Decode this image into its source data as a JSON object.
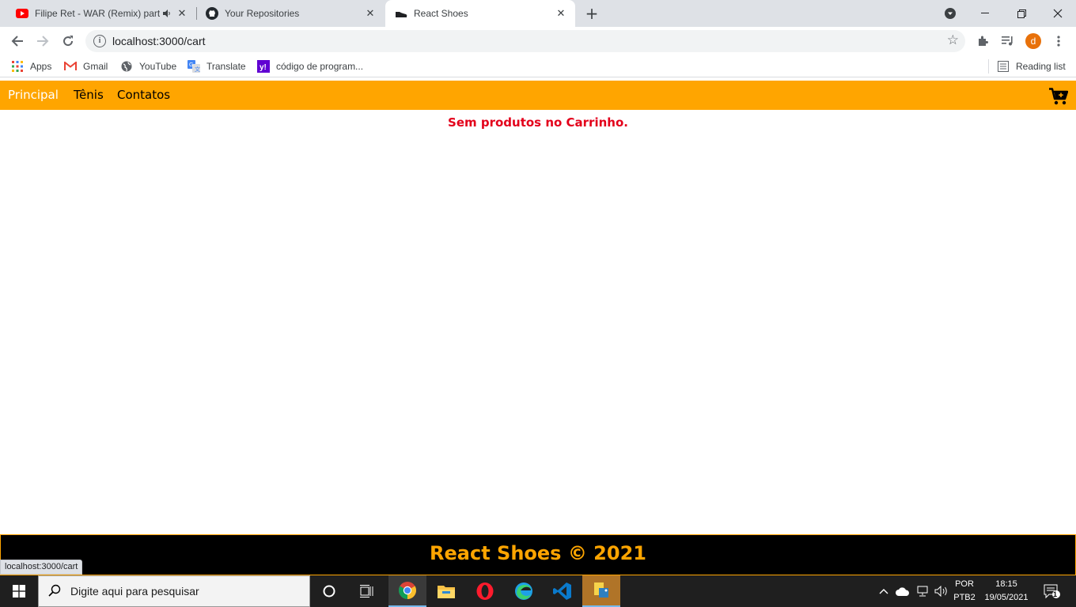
{
  "browser": {
    "tabs": [
      {
        "title": "Filipe Ret - WAR (Remix) part",
        "icon": "youtube-icon"
      },
      {
        "title": "Your Repositories",
        "icon": "github-icon"
      },
      {
        "title": "React Shoes",
        "icon": "shoe-icon"
      }
    ],
    "url": "localhost:3000/cart",
    "profile_initial": "d",
    "bookmarks": [
      {
        "label": "Apps"
      },
      {
        "label": "Gmail"
      },
      {
        "label": "YouTube"
      },
      {
        "label": "Translate"
      },
      {
        "label": "código de program..."
      }
    ],
    "reading_list": "Reading list",
    "status_url": "localhost:3000/cart"
  },
  "app": {
    "nav": [
      {
        "label": "Principal"
      },
      {
        "label": "Tênis"
      },
      {
        "label": "Contatos"
      }
    ],
    "empty_message": "Sem produtos no Carrinho.",
    "footer": "React Shoes © 2021",
    "accent_color": "#ffa500",
    "error_color": "#e3001b"
  },
  "taskbar": {
    "search_placeholder": "Digite aqui para pesquisar",
    "lang_line1": "POR",
    "lang_line2": "PTB2",
    "time": "18:15",
    "date": "19/05/2021",
    "notifications": "1"
  }
}
